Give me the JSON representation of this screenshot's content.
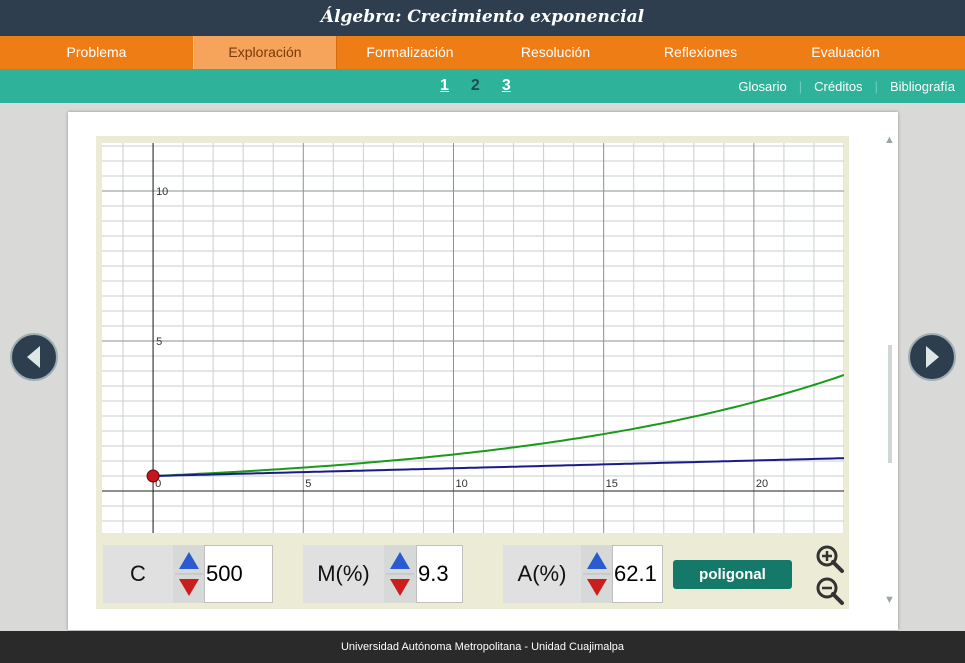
{
  "title": "Álgebra: Crecimiento exponencial",
  "main_nav": [
    {
      "label": "Problema",
      "active": false
    },
    {
      "label": "Exploración",
      "active": true
    },
    {
      "label": "Formalización",
      "active": false
    },
    {
      "label": "Resolución",
      "active": false
    },
    {
      "label": "Reflexiones",
      "active": false
    },
    {
      "label": "Evaluación",
      "active": false
    }
  ],
  "pages": [
    {
      "label": "1",
      "current": false
    },
    {
      "label": "2",
      "current": true
    },
    {
      "label": "3",
      "current": false
    }
  ],
  "top_links": [
    "Glosario",
    "Créditos",
    "Bibliografía"
  ],
  "graph": {
    "x_ticks": [
      "0",
      "5",
      "10",
      "15",
      "20"
    ],
    "y_ticks": [
      "5",
      "10"
    ],
    "x_range": [
      -1.7,
      23
    ],
    "y_range": [
      -1.4,
      11.6
    ],
    "start_point": {
      "x": 0,
      "y": 0.5
    },
    "curves": [
      {
        "name": "",
        "color": "#1a9a1a",
        "type": "exponential",
        "y0": 0.5,
        "rate_pct": 9.3
      },
      {
        "name": "",
        "color": "#1a1a8a",
        "type": "linear",
        "y0": 0.5,
        "slope": 0.0258
      }
    ]
  },
  "controls": {
    "c": {
      "label": "C",
      "value": "500"
    },
    "m": {
      "label": "M(%)",
      "value": "9.3"
    },
    "a": {
      "label": "A(%)",
      "value": "62.1"
    },
    "poligonal_label": "poligonal"
  },
  "colors": {
    "header": "#2e3e4e",
    "nav": "#ef7d15",
    "subnav": "#2fb29a",
    "button": "#15796a"
  },
  "icons": [
    "arrow-left-icon",
    "arrow-right-icon",
    "zoom-in-icon",
    "zoom-out-icon",
    "spin-up-icon",
    "spin-down-icon"
  ],
  "footer": "Universidad Autónoma Metropolitana - Unidad Cuajimalpa"
}
